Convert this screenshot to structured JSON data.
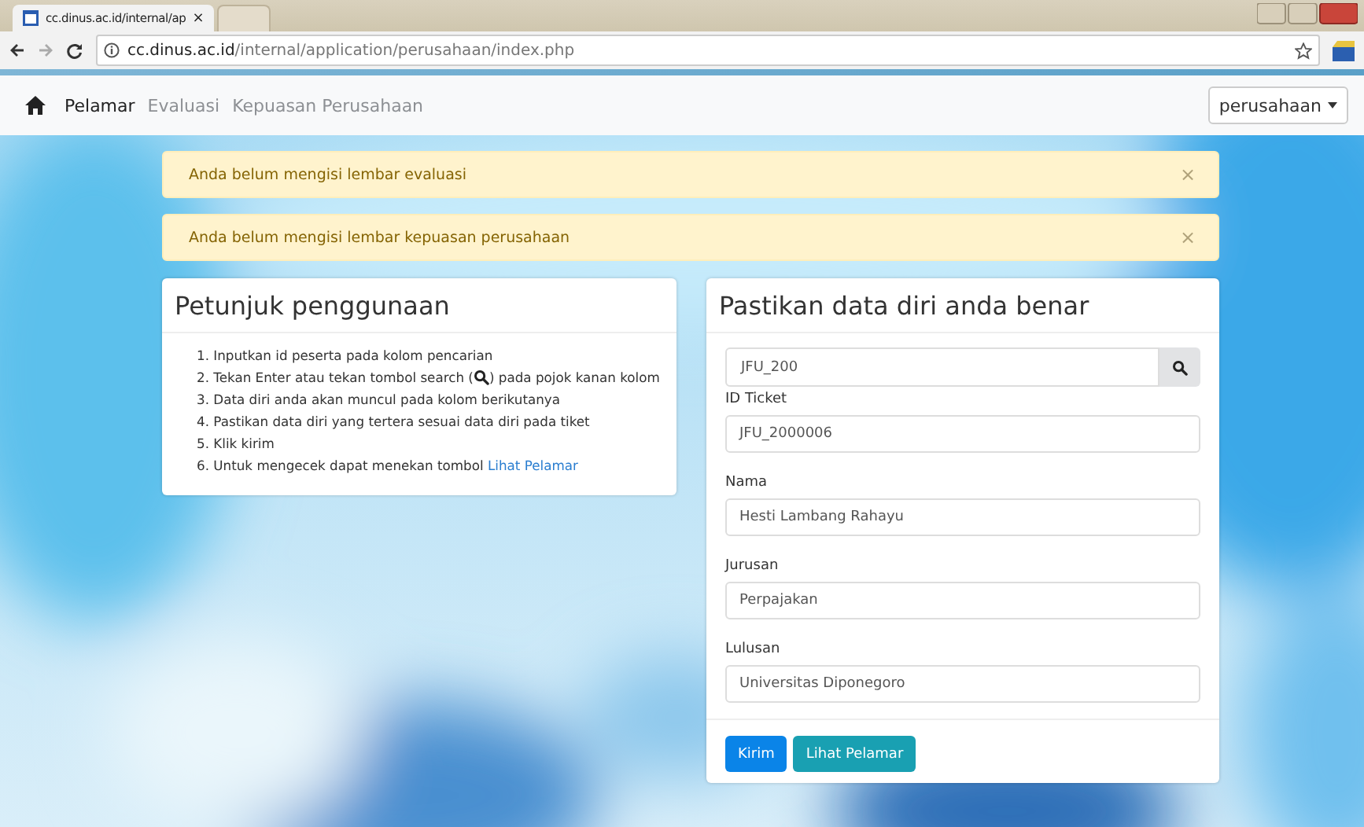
{
  "browser": {
    "tabs": [
      {
        "title": "cc.dinus.ac.id/internal/ap",
        "close": "×",
        "selected": true
      },
      {
        "selected": false
      }
    ],
    "url_domain": "cc.dinus.ac.id",
    "url_path": "/internal/application/perusahaan/index.php"
  },
  "navbar": {
    "items": [
      {
        "label": "Pelamar",
        "selected": true
      },
      {
        "label": "Evaluasi",
        "selected": false
      },
      {
        "label": "Kepuasan Perusahaan",
        "selected": false
      }
    ],
    "user_menu": "perusahaan"
  },
  "alerts": [
    {
      "text": "Anda belum mengisi lembar evaluasi",
      "close": "×"
    },
    {
      "text": "Anda belum mengisi lembar kepuasan perusahaan",
      "close": "×"
    }
  ],
  "help_card": {
    "title": "Petunjuk penggunaan",
    "steps": [
      {
        "kind": "plain",
        "text": "1. Inputkan id peserta pada kolom pencarian"
      },
      {
        "kind": "with_icon",
        "text": "2. Tekan Enter atau tekan tombol search (",
        "after": ") pada pojok kanan kolom"
      },
      {
        "kind": "plain",
        "text": "3. Data diri anda akan muncul pada kolom berikutanya"
      },
      {
        "kind": "plain",
        "text": "4. Pastikan data diri yang tertera sesuai data diri pada tiket"
      },
      {
        "kind": "plain",
        "text": "5. Klik kirim"
      },
      {
        "kind": "with_link",
        "text": "6. Untuk mengecek dapat menekan tombol ",
        "link": "Lihat Pelamar"
      }
    ]
  },
  "form_card": {
    "title": "Pastikan data diri anda benar",
    "search": {
      "value": "JFU_200"
    },
    "fields": [
      {
        "label": "ID Ticket",
        "value": "JFU_2000006"
      },
      {
        "label": "Nama",
        "value": "Hesti Lambang Rahayu"
      },
      {
        "label": "Jurusan",
        "value": "Perpajakan"
      },
      {
        "label": "Lulusan",
        "value": "Universitas Diponegoro"
      }
    ],
    "buttons": [
      {
        "label": "Kirim",
        "kind": "primary"
      },
      {
        "label": "Lihat Pelamar",
        "kind": "info"
      }
    ]
  }
}
